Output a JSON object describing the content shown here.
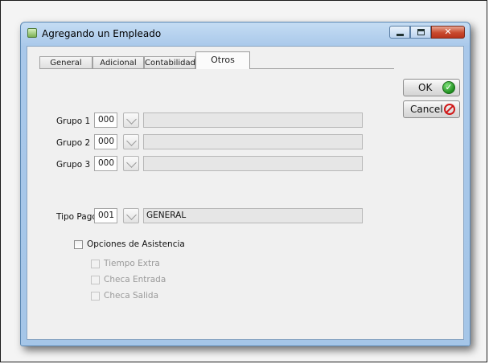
{
  "window": {
    "title": "Agregando un Empleado"
  },
  "tabs": [
    {
      "label": "General"
    },
    {
      "label": "Adicional"
    },
    {
      "label": "Contabilidad"
    },
    {
      "label": "Otros"
    }
  ],
  "buttons": {
    "ok": "OK",
    "cancel": "Cancel"
  },
  "groups": [
    {
      "label": "Grupo 1",
      "code": "000",
      "description": ""
    },
    {
      "label": "Grupo 2",
      "code": "000",
      "description": ""
    },
    {
      "label": "Grupo 3",
      "code": "000",
      "description": ""
    }
  ],
  "tipo_pago": {
    "label": "Tipo Pago",
    "code": "001",
    "description": "GENERAL"
  },
  "asistencia": {
    "label": "Opciones de Asistencia",
    "checked": false,
    "options": [
      {
        "label": "Tiempo Extra",
        "checked": false,
        "enabled": false
      },
      {
        "label": "Checa Entrada",
        "checked": false,
        "enabled": false
      },
      {
        "label": "Checa Salida",
        "checked": false,
        "enabled": false
      }
    ]
  },
  "icons": {
    "window": "app-icon",
    "ok": "check-circle-icon",
    "cancel": "prohibited-icon",
    "lookup": "chevron-down-icon"
  },
  "colors": {
    "window_frame": "#a9c8ea",
    "close_button": "#c94a2e",
    "ok_icon": "#1f8f1f",
    "cancel_icon": "#d01818"
  }
}
